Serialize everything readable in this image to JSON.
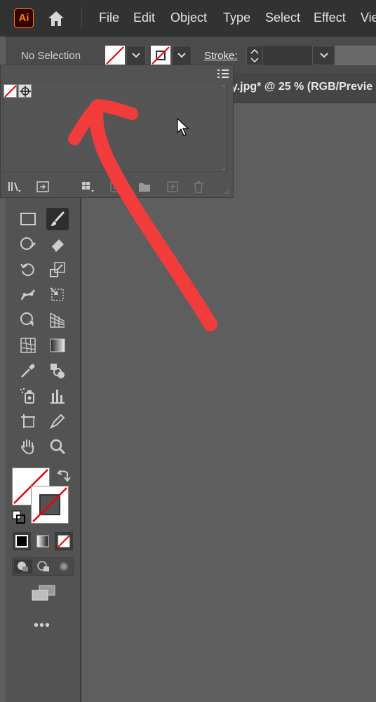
{
  "app": {
    "logo": "Ai",
    "brand_color": "#ff7c00"
  },
  "menu": [
    "File",
    "Edit",
    "Object",
    "Type",
    "Select",
    "Effect",
    "Vie"
  ],
  "control_bar": {
    "selection": "No Selection",
    "stroke_label": "Stroke:"
  },
  "document_tab": {
    "title": "y.jpg* @ 25 % (RGB/Previe"
  },
  "annotation": {
    "color": "#f23c3c"
  },
  "toolbar": {
    "tools": [
      "rectangle-icon",
      "paintbrush-icon",
      "shaper-icon",
      "eraser-icon",
      "rotate-icon",
      "scale-icon",
      "puppet-warp-icon",
      "free-transform-icon",
      "shape-builder-icon",
      "perspective-grid-icon",
      "mesh-icon",
      "gradient-icon",
      "eyedropper-icon",
      "blend-icon",
      "symbol-sprayer-icon",
      "column-graph-icon",
      "artboard-icon",
      "slice-icon",
      "hand-icon",
      "zoom-icon"
    ],
    "more": "•••"
  }
}
